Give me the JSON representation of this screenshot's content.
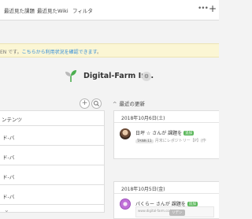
{
  "nav": {
    "tabs": [
      {
        "label": "最近見た課題"
      },
      {
        "label": "最近見たWiki"
      },
      {
        "label": "フィルタ"
      }
    ],
    "more_label": "•••",
    "add_label": "+"
  },
  "notice": {
    "prefix": "EN です。",
    "link": "こちらから利用状況を確認できます",
    "suffix": "。"
  },
  "org": {
    "name": "Digital-Farm Inc."
  },
  "left": {
    "header": "ンテンツ",
    "rows": [
      {
        "label": "ド-バ"
      },
      {
        "label": "ド-バ"
      },
      {
        "label": "ド-バ"
      },
      {
        "label": "ド-バ"
      }
    ]
  },
  "right": {
    "title": "最近の更新",
    "activities": [
      {
        "date": "2018年10月6日(土)",
        "user_line": "日坪 ☆ さんが 課題を",
        "badge": "追加",
        "tag": "TANK-11",
        "detail": "月末にレポジトリー【P】(作"
      },
      {
        "date": "2018年10月5日(金)",
        "user_line": "パくらー さんが 課題を",
        "badge": "追加",
        "thumb_text": "www.digital-farm.co.jp",
        "thumb_button": "リデン"
      }
    ]
  },
  "icons": {
    "more": "more-dots-icon",
    "add": "plus-icon",
    "logo": "sprout-logo-icon",
    "settings": "gear-icon",
    "add_content": "plus-circle-icon",
    "search": "search-icon",
    "collapse": "chevron-up-icon",
    "expand": "chevron-down-icon"
  },
  "colors": {
    "link": "#2f8ad8",
    "notice_bg": "#fbf6d4",
    "badge": "#5cb85c",
    "logo": "#4caf50"
  }
}
